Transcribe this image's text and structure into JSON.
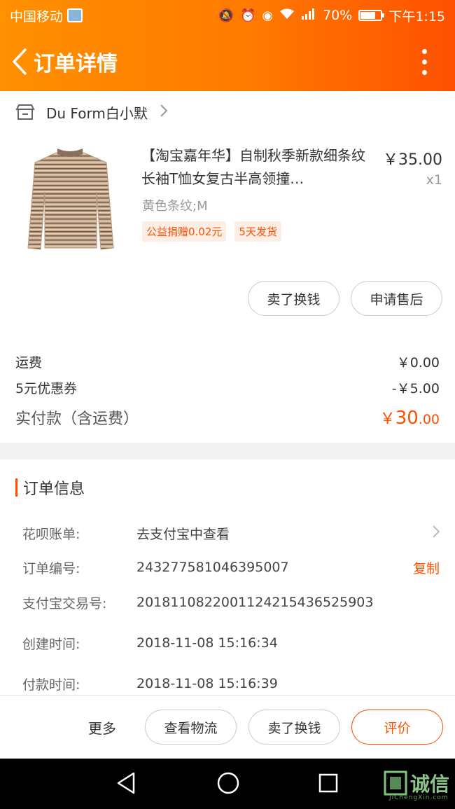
{
  "status_bar": {
    "carrier": "中国移动",
    "battery": "70%",
    "battery_level": 0.7,
    "time": "下午1:15"
  },
  "header": {
    "title": "订单详情"
  },
  "shop": {
    "name": "Du Form白小默"
  },
  "item": {
    "title": "【淘宝嘉年华】自制秋季新款细条纹长袖T恤女复古半高领撞…",
    "price": "￥35.00",
    "quantity": "x1",
    "sku": "黄色条纹;M",
    "tags": [
      "公益捐赠0.02元",
      "5天发货"
    ],
    "actions": [
      "卖了换钱",
      "申请售后"
    ]
  },
  "fees": {
    "shipping_label": "运费",
    "shipping_value": "￥0.00",
    "coupon_label": "5元优惠券",
    "coupon_value": "-￥5.00",
    "total_label": "实付款（含运费）",
    "total_symbol": "￥",
    "total_integer": "30",
    "total_decimal": ".00"
  },
  "order_info": {
    "title": "订单信息",
    "rows": [
      {
        "label": "花呗账单:",
        "value": "去支付宝中查看"
      },
      {
        "label": "订单编号:",
        "value": "243277581046395007",
        "action": "复制"
      },
      {
        "label": "支付宝交易号:",
        "value": "2018110822001124215436525903"
      },
      {
        "label": "创建时间:",
        "value": "2018-11-08 15:16:34"
      },
      {
        "label": "付款时间:",
        "value": "2018-11-08 15:16:39"
      }
    ]
  },
  "bottom_bar": {
    "more": "更多",
    "buttons": [
      "查看物流",
      "卖了换钱",
      "评价"
    ]
  },
  "watermark": {
    "text": "诚信",
    "sub": "JiChengXin.com"
  },
  "colors": {
    "accent": "#ff5000",
    "header_gradient_start": "#ff9000",
    "header_gradient_end": "#ff5000"
  }
}
